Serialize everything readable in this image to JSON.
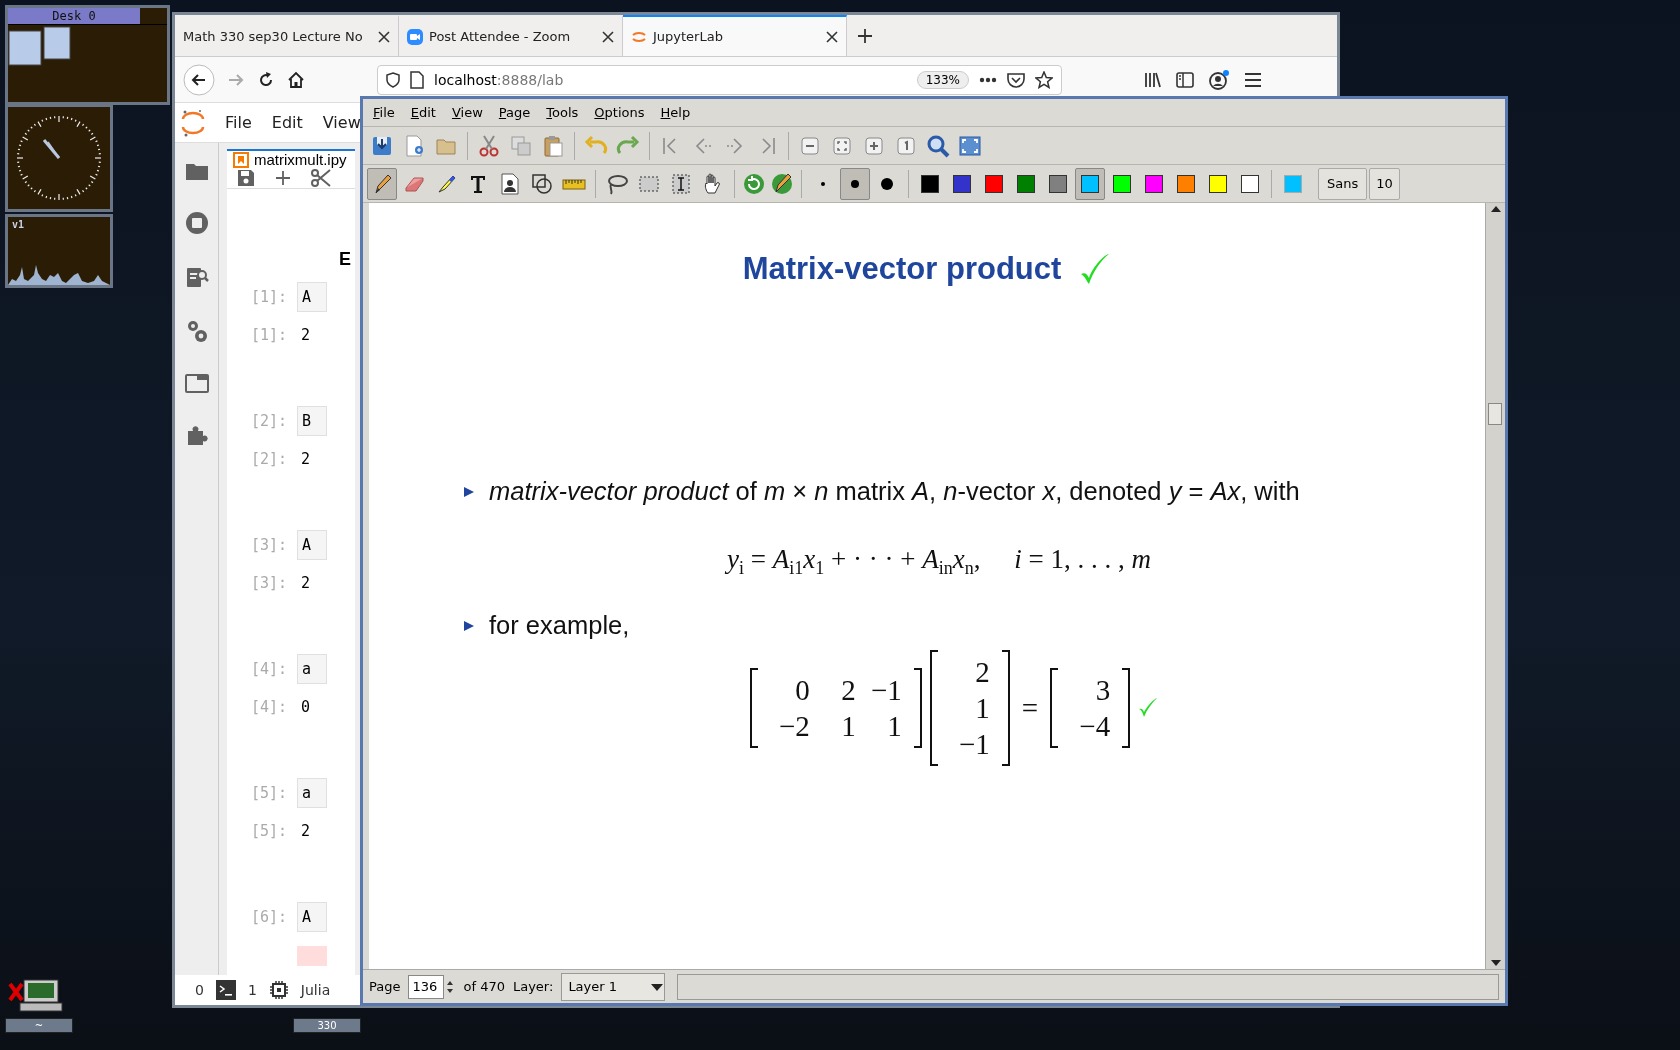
{
  "desktop": {
    "pager": {
      "label": "Desk 0"
    },
    "load_meter": {
      "label": "v1"
    },
    "taskbar": [
      {
        "label": "~"
      },
      {
        "label": "330"
      }
    ]
  },
  "browser": {
    "tabs": [
      {
        "title": "Math 330 sep30 Lecture No",
        "kind": "page",
        "selected": false
      },
      {
        "title": "Post Attendee - Zoom",
        "kind": "zoom",
        "selected": false
      },
      {
        "title": "JupyterLab",
        "kind": "jupyter",
        "selected": true
      }
    ],
    "url_host": "localhost",
    "url_path": ":8888/lab",
    "zoom": "133%"
  },
  "jupyter": {
    "menu": [
      "File",
      "Edit",
      "View"
    ],
    "notebook_tab": "matrixmult.ipy",
    "heading": "E",
    "cells": [
      {
        "in_prompt": "[1]:",
        "input": "A",
        "out_prompt": "[1]:",
        "output": "2",
        "kind": "result"
      },
      {
        "in_prompt": "[2]:",
        "input": "B",
        "out_prompt": "[2]:",
        "output": "2",
        "kind": "result"
      },
      {
        "in_prompt": "[3]:",
        "input": "A",
        "out_prompt": "[3]:",
        "output": "2",
        "kind": "result"
      },
      {
        "in_prompt": "[4]:",
        "input": "a",
        "out_prompt": "[4]:",
        "output": "0",
        "kind": "result"
      },
      {
        "in_prompt": "[5]:",
        "input": "a",
        "out_prompt": "[5]:",
        "output": "2",
        "kind": "result"
      },
      {
        "in_prompt": "[6]:",
        "input": "A",
        "kind": "error"
      }
    ],
    "status": {
      "terminals": "0",
      "kernels": "1",
      "kernel_name": "Julia"
    }
  },
  "xournal": {
    "menu": [
      "File",
      "Edit",
      "View",
      "Page",
      "Tools",
      "Options",
      "Help"
    ],
    "tools": [
      {
        "kind": "pen",
        "selected": true
      },
      {
        "kind": "eraser",
        "selected": false
      },
      {
        "kind": "highlighter",
        "selected": false
      },
      {
        "kind": "text",
        "selected": false
      },
      {
        "kind": "image",
        "selected": false
      },
      {
        "kind": "shapes",
        "selected": false
      },
      {
        "kind": "ruler",
        "selected": false
      },
      {
        "kind": "lasso",
        "selected": false
      },
      {
        "kind": "rect",
        "selected": false
      },
      {
        "kind": "vspace",
        "selected": false
      },
      {
        "kind": "hand",
        "selected": false
      }
    ],
    "pen_sizes": [
      {
        "selected": false
      },
      {
        "selected": true
      },
      {
        "selected": false
      }
    ],
    "colors": [
      {
        "color": "#000000",
        "selected": false
      },
      {
        "color": "#3333cc",
        "selected": false
      },
      {
        "color": "#ff0000",
        "selected": false
      },
      {
        "color": "#008000",
        "selected": false
      },
      {
        "color": "#808080",
        "selected": false
      },
      {
        "color": "#00c0ff",
        "selected": true
      },
      {
        "color": "#00ff00",
        "selected": false
      },
      {
        "color": "#ff00ff",
        "selected": false
      },
      {
        "color": "#ff8000",
        "selected": false
      },
      {
        "color": "#ffff00",
        "selected": false
      },
      {
        "color": "#ffffff",
        "selected": false
      }
    ],
    "font": "Sans",
    "font_size": "10",
    "slide": {
      "title": "Matrix-vector product",
      "bullets": [
        "*matrix-vector product* of *m* × *n* matrix *A*, *n*-vector *x*, denoted *y* = *Ax*, with",
        "for example,"
      ],
      "formula": "*y*$_{i}$ = *A*$_{i1}$*x*$_{1}$ + · · · + *A*$_{in}$*x*$_{n}$,     *i* = 1, . . . , *m*",
      "matrix": [
        [
          "0",
          "2",
          "−1"
        ],
        [
          "−2",
          "1",
          "1"
        ]
      ],
      "vector": [
        "2",
        "1",
        "−1"
      ],
      "equals": "=",
      "result": [
        "3",
        "−4"
      ]
    },
    "status": {
      "page_label": "Page",
      "page": "136",
      "page_total": "of 470",
      "layer_label": "Layer:",
      "layer": "Layer 1"
    }
  }
}
